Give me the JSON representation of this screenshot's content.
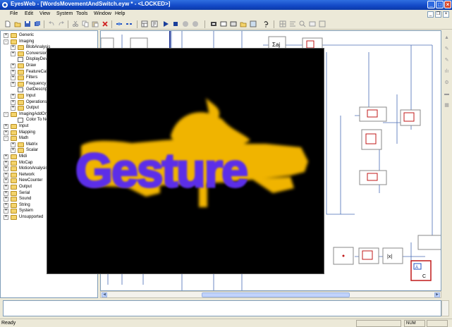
{
  "window": {
    "title": "EyesWeb - [WordsMovementAndSwitch.eyw * - <LOCKED>]",
    "buttons": [
      "minimize",
      "maximize",
      "close"
    ]
  },
  "menu": [
    "File",
    "Edit",
    "View",
    "System",
    "Tools",
    "Window",
    "Help"
  ],
  "toolbar_icons": [
    "new-icon",
    "open-icon",
    "save-icon",
    "save-all-icon",
    "cut-icon",
    "copy-icon",
    "paste-icon",
    "delete-icon",
    "connect-icon",
    "disconnect-icon",
    "run-icon",
    "step-icon",
    "play-icon",
    "stop-icon",
    "pause-icon",
    "record-icon",
    "layout-icon",
    "properties-icon",
    "help-icon",
    "grid-icon",
    "zoom-icon"
  ],
  "tree": [
    {
      "label": "Generic",
      "level": 0,
      "exp": "+",
      "type": "folder"
    },
    {
      "label": "Imaging",
      "level": 0,
      "exp": "-",
      "type": "folder"
    },
    {
      "label": "BlobAnalysis",
      "level": 1,
      "exp": "+",
      "type": "folder"
    },
    {
      "label": "Conversion",
      "level": 1,
      "exp": "+",
      "type": "folder"
    },
    {
      "label": "DisplayDevice",
      "level": 1,
      "exp": "",
      "type": "leaf"
    },
    {
      "label": "Draw",
      "level": 1,
      "exp": "+",
      "type": "folder"
    },
    {
      "label": "FeatureCalc",
      "level": 1,
      "exp": "+",
      "type": "folder"
    },
    {
      "label": "Filters",
      "level": 1,
      "exp": "+",
      "type": "folder"
    },
    {
      "label": "Frequency",
      "level": 1,
      "exp": "+",
      "type": "folder"
    },
    {
      "label": "GetDescriptor",
      "level": 1,
      "exp": "",
      "type": "leaf"
    },
    {
      "label": "Input",
      "level": 1,
      "exp": "+",
      "type": "folder"
    },
    {
      "label": "Operations",
      "level": 1,
      "exp": "+",
      "type": "folder"
    },
    {
      "label": "Output",
      "level": 1,
      "exp": "+",
      "type": "folder"
    },
    {
      "label": "ImagingAddOn",
      "level": 0,
      "exp": "-",
      "type": "folder"
    },
    {
      "label": "Color To Norm",
      "level": 1,
      "exp": "",
      "type": "leaf"
    },
    {
      "label": "Input",
      "level": 0,
      "exp": "+",
      "type": "folder"
    },
    {
      "label": "Mapping",
      "level": 0,
      "exp": "+",
      "type": "folder"
    },
    {
      "label": "Math",
      "level": 0,
      "exp": "-",
      "type": "folder"
    },
    {
      "label": "Matrix",
      "level": 1,
      "exp": "+",
      "type": "folder"
    },
    {
      "label": "Scalar",
      "level": 1,
      "exp": "+",
      "type": "folder"
    },
    {
      "label": "Midi",
      "level": 0,
      "exp": "+",
      "type": "folder"
    },
    {
      "label": "MoCap",
      "level": 0,
      "exp": "+",
      "type": "folder"
    },
    {
      "label": "MotionAnalysis",
      "level": 0,
      "exp": "+",
      "type": "folder"
    },
    {
      "label": "Network",
      "level": 0,
      "exp": "+",
      "type": "folder"
    },
    {
      "label": "NewCounter",
      "level": 0,
      "exp": "+",
      "type": "folder"
    },
    {
      "label": "Output",
      "level": 0,
      "exp": "+",
      "type": "folder"
    },
    {
      "label": "Serial",
      "level": 0,
      "exp": "+",
      "type": "folder"
    },
    {
      "label": "Sound",
      "level": 0,
      "exp": "+",
      "type": "folder"
    },
    {
      "label": "String",
      "level": 0,
      "exp": "+",
      "type": "folder"
    },
    {
      "label": "System",
      "level": 0,
      "exp": "+",
      "type": "folder"
    },
    {
      "label": "Unsupported",
      "level": 0,
      "exp": "+",
      "type": "folder"
    }
  ],
  "canvas_blocks": {
    "sum_label": "Σaj",
    "abs_label": "|x|",
    "a_label": "A",
    "c_label": "C"
  },
  "display": {
    "gesture_text": "Gesture",
    "text_color": "#5b2de8",
    "shadow_color": "#f0b400"
  },
  "status": {
    "text": "Ready",
    "num": "NUM"
  },
  "colors": {
    "titlebar": "#1248c6",
    "chrome": "#ece9d8",
    "block_red": "#c01818"
  }
}
